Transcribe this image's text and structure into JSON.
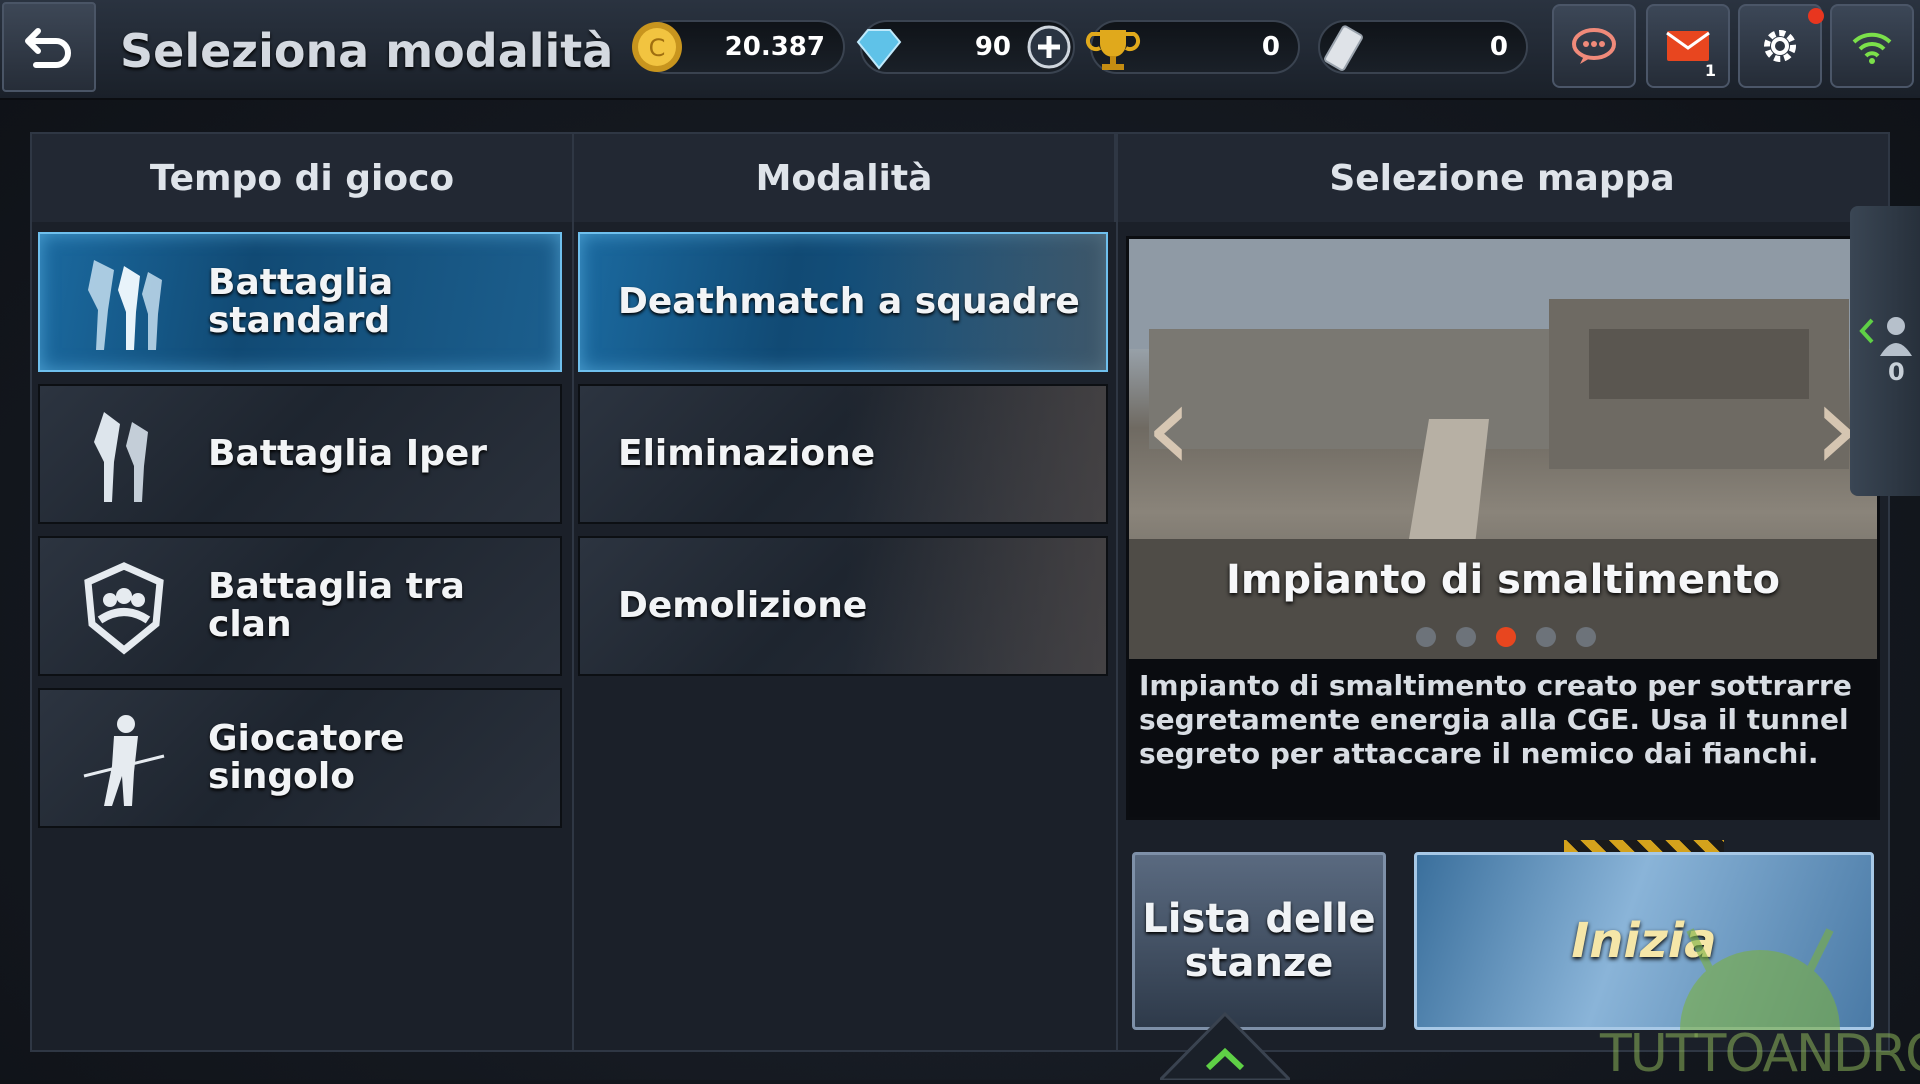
{
  "header": {
    "title": "Seleziona modalità",
    "currencies": [
      {
        "icon": "coin-icon",
        "value": "20.387"
      },
      {
        "icon": "diamond-icon",
        "value": "90"
      },
      {
        "icon": "trophy-icon",
        "value": "0"
      },
      {
        "icon": "card-icon",
        "value": "0"
      }
    ],
    "mail_count": "1"
  },
  "columns": {
    "play_time": "Tempo di gioco",
    "mode": "Modalità",
    "map_select": "Selezione mappa"
  },
  "battle_types": [
    {
      "label_line1": "Battaglia",
      "label_line2": "standard",
      "selected": true
    },
    {
      "label": "Battaglia Iper",
      "selected": false
    },
    {
      "label": "Battaglia tra clan",
      "selected": false
    },
    {
      "label": "Giocatore singolo",
      "selected": false
    }
  ],
  "game_modes": [
    {
      "label": "Deathmatch a squadre",
      "selected": true
    },
    {
      "label": "Eliminazione",
      "selected": false
    },
    {
      "label": "Demolizione",
      "selected": false
    }
  ],
  "map": {
    "name": "Impianto di smaltimento",
    "description": "Impianto di smaltimento creato per sottrarre segretamente energia alla CGE. Usa il tunnel segreto per attaccare il nemico dai fianchi.",
    "page_count": 5,
    "active_page": 3
  },
  "side_tab": {
    "count": "0"
  },
  "buttons": {
    "rooms_line1": "Lista delle",
    "rooms_line2": "stanze",
    "start": "Inizia"
  },
  "watermark": "TUTTOANDROID",
  "colors": {
    "selected_blue": "#1b6aa0",
    "active_dot": "#e8461f",
    "notification_red": "#e8361f"
  }
}
